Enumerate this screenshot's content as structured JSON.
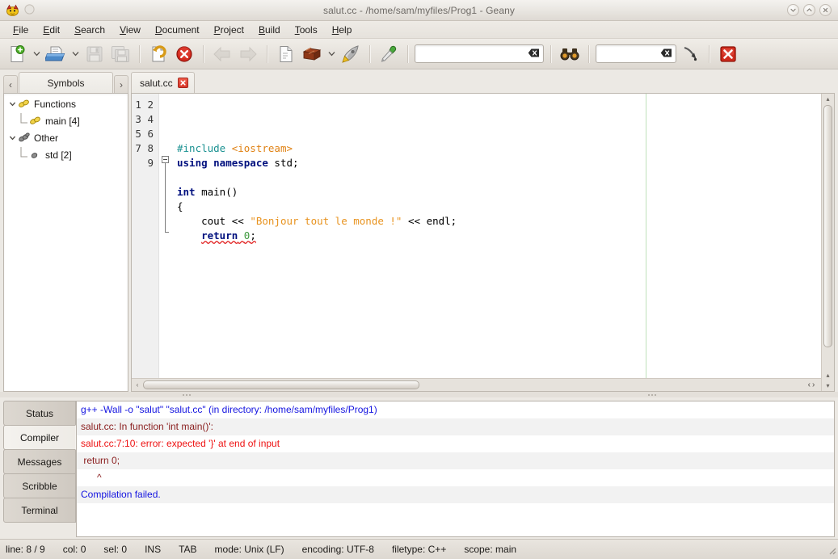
{
  "window": {
    "title": "salut.cc - /home/sam/myfiles/Prog1 - Geany",
    "buttons": {
      "minimize": "minimize-icon",
      "maximize": "maximize-icon",
      "close": "close-icon"
    },
    "app_icon": "geany-logo-icon"
  },
  "menubar": {
    "items": [
      {
        "label": "File",
        "mnemonic": "F"
      },
      {
        "label": "Edit",
        "mnemonic": "E"
      },
      {
        "label": "Search",
        "mnemonic": "S"
      },
      {
        "label": "View",
        "mnemonic": "V"
      },
      {
        "label": "Document",
        "mnemonic": "D"
      },
      {
        "label": "Project",
        "mnemonic": "P"
      },
      {
        "label": "Build",
        "mnemonic": "B"
      },
      {
        "label": "Tools",
        "mnemonic": "T"
      },
      {
        "label": "Help",
        "mnemonic": "H"
      }
    ]
  },
  "toolbar": {
    "buttons": [
      {
        "name": "new-file-button",
        "icon": "new-document-icon",
        "enabled": true
      },
      {
        "name": "new-file-menu-button",
        "icon": "chevron-down-icon",
        "enabled": true
      },
      {
        "name": "open-file-button",
        "icon": "open-folder-icon",
        "enabled": true
      },
      {
        "name": "open-recent-menu-button",
        "icon": "chevron-down-icon",
        "enabled": true
      },
      {
        "name": "save-button",
        "icon": "floppy-save-icon",
        "enabled": false
      },
      {
        "name": "save-all-button",
        "icon": "save-all-icon",
        "enabled": false
      },
      {
        "name": "revert-button",
        "icon": "undo-arrow-icon",
        "enabled": true
      },
      {
        "name": "close-document-button",
        "icon": "red-x-circle-icon",
        "enabled": true
      },
      {
        "name": "navigate-back-button",
        "icon": "arrow-left-icon",
        "enabled": false
      },
      {
        "name": "navigate-forward-button",
        "icon": "arrow-right-icon",
        "enabled": false
      },
      {
        "name": "compile-button",
        "icon": "compile-page-icon",
        "enabled": true
      },
      {
        "name": "build-button",
        "icon": "brick-build-icon",
        "enabled": true
      },
      {
        "name": "build-menu-button",
        "icon": "chevron-down-icon",
        "enabled": true
      },
      {
        "name": "run-button",
        "icon": "rocket-run-icon",
        "enabled": true
      },
      {
        "name": "color-chooser-button",
        "icon": "eyedropper-icon",
        "enabled": true
      },
      {
        "name": "find-button",
        "icon": "binoculars-icon",
        "enabled": true
      },
      {
        "name": "jump-to-line-button",
        "icon": "jump-arrow-icon",
        "enabled": true
      },
      {
        "name": "quit-button",
        "icon": "quit-red-x-icon",
        "enabled": true
      }
    ],
    "search_entry": {
      "value": "",
      "placeholder": "",
      "clear_icon": "clear-entry-icon"
    },
    "goto_entry": {
      "value": "",
      "placeholder": "",
      "clear_icon": "clear-entry-icon"
    }
  },
  "sidebar": {
    "prev_arrow": "‹",
    "next_arrow": "›",
    "tab_label": "Symbols",
    "tree": [
      {
        "label": "Functions",
        "icon": "function-group-icon",
        "level": 0,
        "expander": "▾",
        "expanded": true
      },
      {
        "label": "main [4]",
        "icon": "function-icon",
        "level": 1,
        "expander": "",
        "expanded": false
      },
      {
        "label": "Other",
        "icon": "other-group-icon",
        "level": 0,
        "expander": "▾",
        "expanded": true
      },
      {
        "label": "std [2]",
        "icon": "namespace-icon",
        "level": 1,
        "expander": "",
        "expanded": false
      }
    ]
  },
  "editor": {
    "tab": {
      "label": "salut.cc",
      "close_icon": "tab-close-icon"
    },
    "line_numbers": [
      "1",
      "2",
      "3",
      "4",
      "5",
      "6",
      "7",
      "8",
      "9"
    ],
    "lines": [
      {
        "n": 1,
        "tokens": [
          {
            "t": "#include ",
            "c": "pre"
          },
          {
            "t": "<iostream>",
            "c": "inc"
          }
        ]
      },
      {
        "n": 2,
        "tokens": [
          {
            "t": "using namespace ",
            "c": "kw"
          },
          {
            "t": "std;",
            "c": "plain"
          }
        ]
      },
      {
        "n": 3,
        "tokens": []
      },
      {
        "n": 4,
        "tokens": [
          {
            "t": "int ",
            "c": "kw"
          },
          {
            "t": "main()",
            "c": "plain"
          }
        ]
      },
      {
        "n": 5,
        "tokens": [
          {
            "t": "{",
            "c": "plain"
          }
        ]
      },
      {
        "n": 6,
        "tokens": [
          {
            "t": "    cout << ",
            "c": "plain"
          },
          {
            "t": "\"Bonjour tout le monde !\"",
            "c": "str"
          },
          {
            "t": " << endl;",
            "c": "plain"
          }
        ]
      },
      {
        "n": 7,
        "tokens": [
          {
            "t": "    ",
            "c": "plain"
          },
          {
            "t": "return",
            "c": "kw",
            "squiggle": true
          },
          {
            "t": " ",
            "c": "plain",
            "squiggle": true
          },
          {
            "t": "0",
            "c": "num",
            "squiggle": true
          },
          {
            "t": ";",
            "c": "plain",
            "squiggle": true
          }
        ]
      },
      {
        "n": 8,
        "tokens": []
      },
      {
        "n": 9,
        "tokens": []
      }
    ],
    "fold_marker": "collapse-fold-icon",
    "margin_line_color": "#bfe0bb",
    "vscroll": {
      "up": "▴",
      "down": "▾"
    },
    "hscroll": {
      "left": "‹",
      "right": "›"
    },
    "corner_prev": "‹",
    "corner_next": "›"
  },
  "messages": {
    "tabs": [
      {
        "label": "Status",
        "active": false
      },
      {
        "label": "Compiler",
        "active": true
      },
      {
        "label": "Messages",
        "active": false
      },
      {
        "label": "Scribble",
        "active": false
      },
      {
        "label": "Terminal",
        "active": false
      }
    ],
    "lines": [
      {
        "text": "g++ -Wall -o \"salut\" \"salut.cc\" (in directory: /home/sam/myfiles/Prog1)",
        "color": "#1414e0"
      },
      {
        "text": "salut.cc: In function 'int main()':",
        "color": "#8b2020"
      },
      {
        "text": "salut.cc:7:10: error: expected '}' at end of input",
        "color": "#ee1111"
      },
      {
        "text": " return 0;",
        "color": "#8b2020"
      },
      {
        "text": "      ^",
        "color": "#8b2020"
      },
      {
        "text": "Compilation failed.",
        "color": "#1414e0"
      },
      {
        "text": "",
        "color": "#000000"
      }
    ]
  },
  "statusbar": {
    "items": [
      "line: 8 / 9",
      "col: 0",
      "sel: 0",
      "INS",
      "TAB",
      "mode: Unix (LF)",
      "encoding: UTF-8",
      "filetype: C++",
      "scope: main"
    ]
  }
}
